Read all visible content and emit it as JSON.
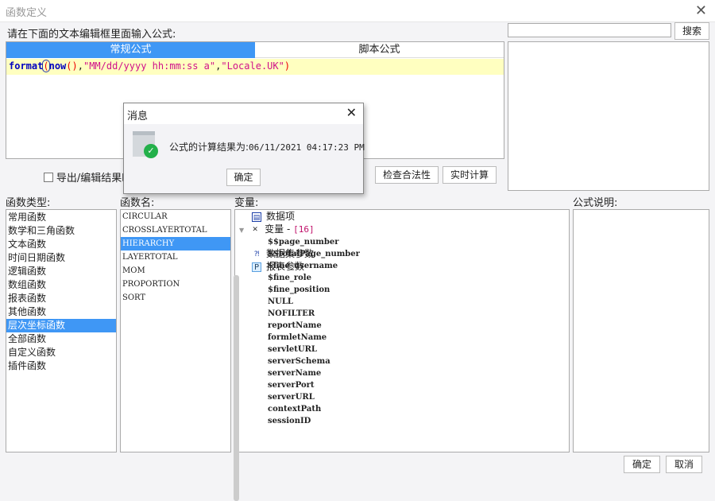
{
  "window": {
    "title": "函数定义",
    "close": "✕"
  },
  "editor": {
    "prompt": "请在下面的文本编辑框里面输入公式:",
    "tabs": [
      {
        "label": "常规公式"
      },
      {
        "label": "脚本公式"
      }
    ],
    "formula": {
      "func": "format",
      "paren": "(",
      "inner": "now",
      "call": "()",
      "sep1": ",",
      "fmt": "\"MM/dd/yyyy hh:mm:ss a\"",
      "sep2": ",",
      "loc": "\"Locale.UK\"",
      "close": ")"
    }
  },
  "search": {
    "value": "",
    "button": "搜索"
  },
  "export_checkbox": {
    "label": "导出/编辑结果时"
  },
  "buttons": {
    "check": "检查合法性",
    "realtime": "实时计算",
    "ok": "确定",
    "cancel": "取消"
  },
  "categories": {
    "label": "函数类型:",
    "items": [
      "常用函数",
      "数学和三角函数",
      "文本函数",
      "时间日期函数",
      "逻辑函数",
      "数组函数",
      "报表函数",
      "其他函数",
      "层次坐标函数",
      "全部函数",
      "自定义函数",
      "插件函数"
    ],
    "selected": "层次坐标函数"
  },
  "functions": {
    "label": "函数名:",
    "items": [
      "CIRCULAR",
      "CROSSLAYERTOTAL",
      "HIERARCHY",
      "LAYERTOTAL",
      "MOM",
      "PROPORTION",
      "SORT"
    ],
    "selected": "HIERARCHY"
  },
  "variables": {
    "label": "变量:",
    "data_items": "数据项",
    "var_group": "变量 - ",
    "var_count": "[16]",
    "items": [
      "$$page_number",
      "$$totalPage_number",
      "$fine_username",
      "$fine_role",
      "$fine_position",
      "NULL",
      "NOFILTER",
      "reportName",
      "formletName",
      "servletURL",
      "serverSchema",
      "serverName",
      "serverPort",
      "serverURL",
      "contextPath",
      "sessionID"
    ],
    "dataset_params": "数据集参数",
    "report_params": "报表参数"
  },
  "description": {
    "label": "公式说明:"
  },
  "message": {
    "title": "消息",
    "close": "✕",
    "text": "公式的计算结果为:",
    "result": "06/11/2021 04:17:23 PM",
    "ok": "确定"
  }
}
